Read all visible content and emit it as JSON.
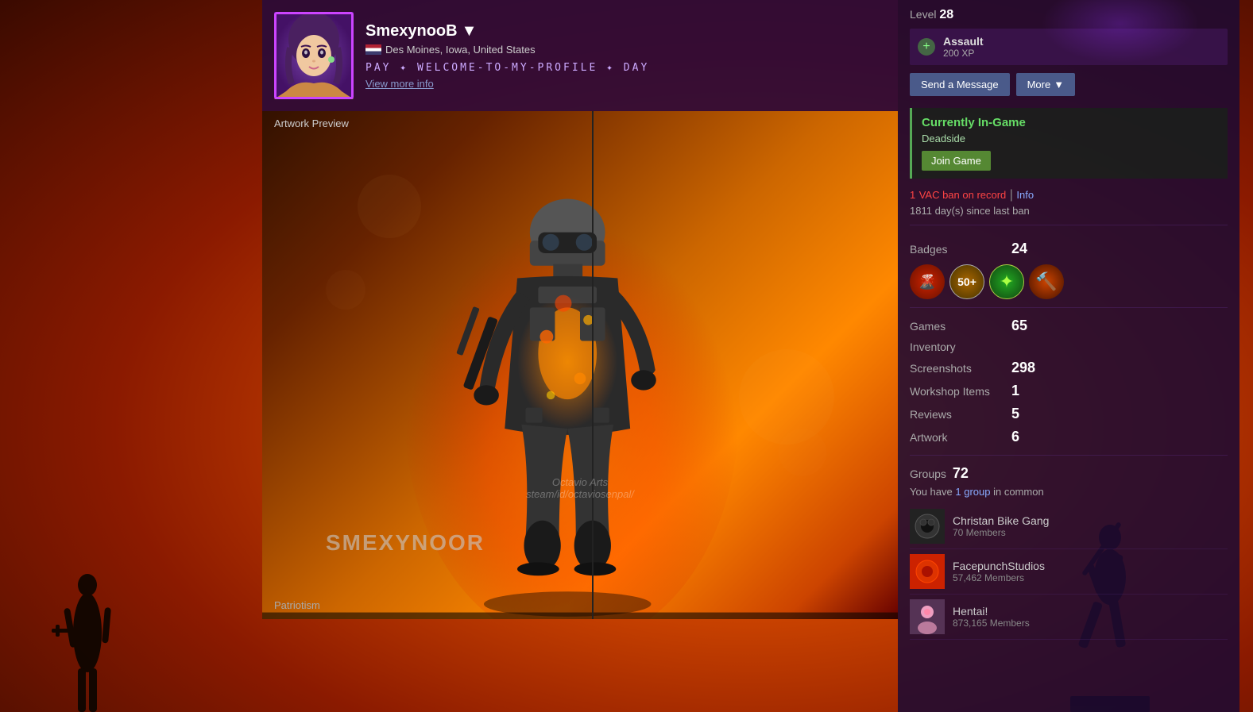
{
  "background": {
    "description": "Orange sunset gradient background with silhouettes"
  },
  "profile": {
    "username": "SmexynooB",
    "username_arrow": "▼",
    "location": "Des Moines, Iowa, United States",
    "banner_text": "PAY ✦ WELCOME-TO-MY-PROFILE ✦ DAY",
    "view_more_label": "View more info",
    "avatar_emoji": "👧"
  },
  "level": {
    "label": "Level",
    "number": "28",
    "xp_game": "Assault",
    "xp_value": "200 XP"
  },
  "actions": {
    "send_message_label": "Send a Message",
    "more_label": "More",
    "more_arrow": "▼"
  },
  "in_game": {
    "status_label": "Currently In-Game",
    "game_name": "Deadside",
    "join_label": "Join Game"
  },
  "vac": {
    "ban_count": "1",
    "ban_text": "VAC ban on record",
    "info_link": "Info",
    "days_text": "1811 day(s) since last ban"
  },
  "stats": {
    "badges_label": "Badges",
    "badges_count": "24",
    "games_label": "Games",
    "games_count": "65",
    "inventory_label": "Inventory",
    "inventory_value": "",
    "screenshots_label": "Screenshots",
    "screenshots_count": "298",
    "workshop_label": "Workshop Items",
    "workshop_count": "1",
    "reviews_label": "Reviews",
    "reviews_count": "5",
    "artwork_label": "Artwork",
    "artwork_count": "6"
  },
  "groups": {
    "label": "Groups",
    "count": "72",
    "common_text": "You have",
    "common_count": "1 group",
    "common_suffix": "in common",
    "items": [
      {
        "name": "Christan Bike Gang",
        "members": "70 Members",
        "icon": "⚙️",
        "bg": "#222"
      },
      {
        "name": "FacepunchStudios",
        "members": "57,462 Members",
        "icon": "🔴",
        "bg": "#cc2200"
      },
      {
        "name": "Hentai!",
        "members": "873,165 Members",
        "icon": "🌸",
        "bg": "#553355"
      }
    ]
  },
  "artwork": {
    "label": "Artwork Preview",
    "watermark": "Octavio Arts\nsteam/id/octaviosenpal/",
    "username_text": "SMEXYNOOR",
    "title": "Patriotism"
  }
}
